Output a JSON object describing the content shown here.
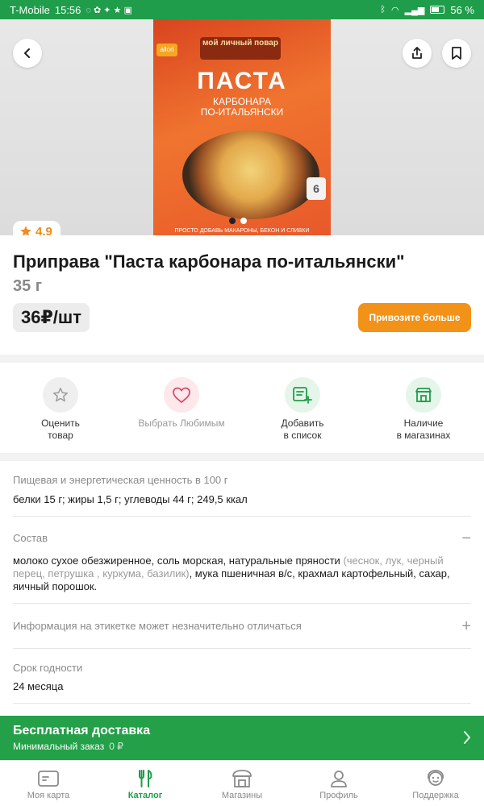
{
  "status_bar": {
    "carrier": "T-Mobile",
    "time": "15:56",
    "battery": "56 %"
  },
  "hero": {
    "package_brand_left": "allori",
    "package_brand": "мой личный повар",
    "package_title": "ПАСТА",
    "package_subtitle_1": "КАРБОНАРА",
    "package_subtitle_2": "ПО-ИТАЛЬЯНСКИ",
    "package_portions": "6",
    "package_bottom": "ПРОСТО ДОБАВЬ МАКАРОНЫ, БЕКОН И СЛИВКИ",
    "slides_total": 2,
    "slide_active": 1
  },
  "rating": {
    "value": "4.9"
  },
  "product": {
    "title": "Приправа \"Паста карбонара по-итальянски\"",
    "weight": "35 г",
    "price": "36₽/шт",
    "bring_more_button": "Привозите больше"
  },
  "actions": [
    {
      "label": "Оценить\nтовар"
    },
    {
      "label": "Выбрать Любимым"
    },
    {
      "label": "Добавить\nв список"
    },
    {
      "label": "Наличие\nв магазинах"
    }
  ],
  "nutrition": {
    "caption": "Пищевая и энергетическая ценность в 100 г",
    "value": "белки 15 г; жиры 1,5 г; углеводы 44 г; 249,5 ккал"
  },
  "composition": {
    "caption": "Состав",
    "toggle": "−",
    "part1": "молоко сухое обезжиренное, соль морская, натуральные пряности ",
    "part_grey": "(чеснок, лук, черный перец, петрушка , куркума, базилик)",
    "part2": ", мука пшеничная в/с, крахмал картофельный, сахар, яичный порошок."
  },
  "label_info": {
    "caption": "Информация на этикетке может незначительно отличаться",
    "toggle": "+"
  },
  "shelf_life": {
    "caption": "Срок годности",
    "value": "24 месяца"
  },
  "delivery": {
    "title": "Бесплатная доставка",
    "min_order_label": "Минимальный заказ",
    "min_order_value": "0 ₽"
  },
  "tabs": [
    {
      "label": "Моя карта",
      "icon": "card-icon"
    },
    {
      "label": "Каталог",
      "icon": "fork-knife-icon",
      "active": true
    },
    {
      "label": "Магазины",
      "icon": "store-icon"
    },
    {
      "label": "Профиль",
      "icon": "profile-icon"
    },
    {
      "label": "Поддержка",
      "icon": "support-icon"
    }
  ],
  "colors": {
    "brand_green": "#1f9d4a",
    "accent_orange": "#f39218",
    "rating_orange": "#f08c1a"
  }
}
